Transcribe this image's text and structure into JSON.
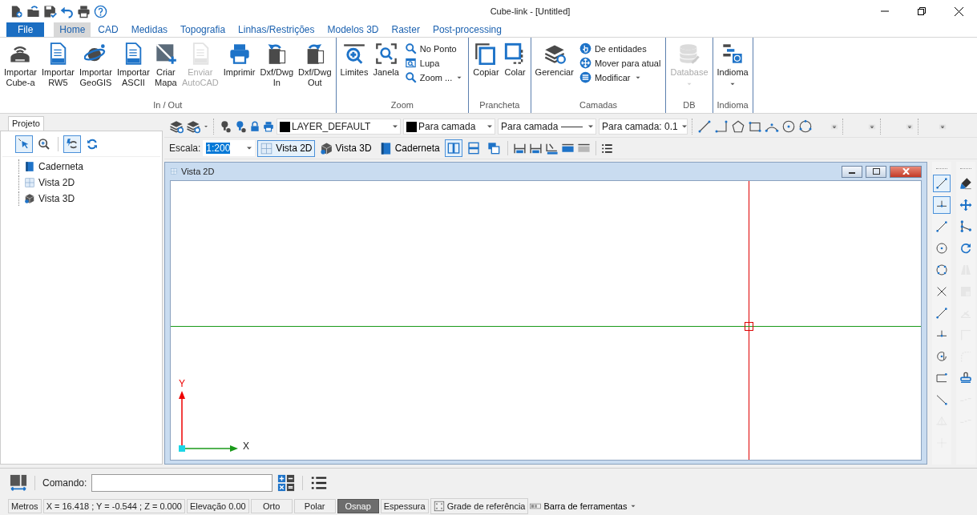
{
  "window": {
    "title": "Cube-link - [Untitled]"
  },
  "menu_tabs": [
    {
      "label": "File",
      "kind": "file",
      "selected": false
    },
    {
      "label": "Home",
      "kind": "tab",
      "selected": true
    },
    {
      "label": "CAD",
      "kind": "tab",
      "selected": false
    },
    {
      "label": "Medidas",
      "kind": "tab",
      "selected": false
    },
    {
      "label": "Topografia",
      "kind": "tab",
      "selected": false
    },
    {
      "label": "Linhas/Restrições",
      "kind": "tab",
      "selected": false
    },
    {
      "label": "Modelos 3D",
      "kind": "tab",
      "selected": false
    },
    {
      "label": "Raster",
      "kind": "tab",
      "selected": false
    },
    {
      "label": "Post-processing",
      "kind": "tab",
      "selected": false
    }
  ],
  "ribbon": {
    "groups": [
      {
        "label": "In / Out",
        "buttons": [
          {
            "label": "Importar\nCube-a",
            "kind": "large",
            "disabled": false,
            "dropdown": false
          },
          {
            "label": "Importar\nRW5",
            "kind": "large",
            "disabled": false,
            "dropdown": false
          },
          {
            "label": "Importar\nGeoGIS",
            "kind": "large",
            "disabled": false,
            "dropdown": false
          },
          {
            "label": "Importar\nASCII",
            "kind": "large",
            "disabled": false,
            "dropdown": false
          },
          {
            "label": "Criar\nMapa",
            "kind": "large",
            "disabled": false,
            "dropdown": false
          },
          {
            "label": "Enviar\nAutoCAD",
            "kind": "large",
            "disabled": true,
            "dropdown": false
          },
          {
            "label": "Imprimir",
            "kind": "large",
            "disabled": false,
            "dropdown": false
          },
          {
            "label": "Dxf/Dwg\nIn",
            "kind": "large",
            "disabled": false,
            "dropdown": false
          },
          {
            "label": "Dxf/Dwg\nOut",
            "kind": "large",
            "disabled": false,
            "dropdown": false
          }
        ]
      },
      {
        "label": "Zoom",
        "buttons": [
          {
            "label": "Limites",
            "kind": "large",
            "disabled": false,
            "dropdown": false
          },
          {
            "label": "Janela",
            "kind": "large",
            "disabled": false,
            "dropdown": false
          },
          {
            "label": "No Ponto",
            "kind": "small",
            "disabled": false,
            "dropdown": false
          },
          {
            "label": "Lupa",
            "kind": "small",
            "disabled": false,
            "dropdown": false
          },
          {
            "label": "Zoom ...",
            "kind": "small",
            "disabled": false,
            "dropdown": true
          }
        ]
      },
      {
        "label": "Prancheta",
        "buttons": [
          {
            "label": "Copiar",
            "kind": "large",
            "disabled": false,
            "dropdown": false
          },
          {
            "label": "Colar",
            "kind": "large",
            "disabled": false,
            "dropdown": false
          }
        ]
      },
      {
        "label": "Camadas",
        "buttons": [
          {
            "label": "Gerenciar",
            "kind": "large",
            "disabled": false,
            "dropdown": false
          },
          {
            "label": "De entidades",
            "kind": "small",
            "disabled": false,
            "dropdown": false
          },
          {
            "label": "Mover para atual",
            "kind": "small",
            "disabled": false,
            "dropdown": false
          },
          {
            "label": "Modificar",
            "kind": "small",
            "disabled": false,
            "dropdown": true
          }
        ]
      },
      {
        "label": "DB",
        "buttons": [
          {
            "label": "Database",
            "kind": "large",
            "disabled": true,
            "dropdown": true
          }
        ]
      },
      {
        "label": "Indioma",
        "buttons": [
          {
            "label": "Indioma",
            "kind": "large",
            "disabled": false,
            "dropdown": true
          }
        ]
      }
    ]
  },
  "layer_toolbar": {
    "layer": "LAYER_DEFAULT",
    "color_mode": "Para camada",
    "linetype": "Para camada",
    "lineweight": "Para camada: 0.1"
  },
  "view_toolbar": {
    "scale_label": "Escala:",
    "scale": "1:200",
    "scale_selected": true,
    "views": [
      {
        "label": "Vista 2D",
        "selected": true
      },
      {
        "label": "Vista 3D",
        "selected": false
      },
      {
        "label": "Caderneta",
        "selected": false
      }
    ],
    "layouts": [
      {
        "selected": true
      },
      {
        "selected": false
      },
      {
        "selected": false
      }
    ]
  },
  "project_panel": {
    "tab": "Projeto",
    "tools": [
      {
        "selected": true
      },
      {
        "selected": false
      },
      {
        "selected": true
      },
      {
        "selected": false
      }
    ],
    "tree": [
      {
        "label": "Caderneta"
      },
      {
        "label": "Vista 2D"
      },
      {
        "label": "Vista 3D"
      }
    ]
  },
  "document": {
    "title": "Vista 2D",
    "axis_y": "Y",
    "axis_x": "X"
  },
  "draw_toolbar": [
    {
      "selected": true,
      "disabled": false
    },
    {
      "selected": true,
      "disabled": false
    },
    {
      "selected": false,
      "disabled": false
    },
    {
      "selected": false,
      "disabled": false
    },
    {
      "selected": false,
      "disabled": false
    },
    {
      "selected": false,
      "disabled": false
    },
    {
      "selected": false,
      "disabled": false
    },
    {
      "selected": false,
      "disabled": false
    },
    {
      "selected": false,
      "disabled": false
    },
    {
      "selected": false,
      "disabled": false
    },
    {
      "selected": false,
      "disabled": false
    },
    {
      "selected": false,
      "disabled": true
    },
    {
      "selected": false,
      "disabled": true
    }
  ],
  "edit_toolbar": [
    {
      "selected": false,
      "disabled": false
    },
    {
      "selected": false,
      "disabled": false
    },
    {
      "selected": false,
      "disabled": false
    },
    {
      "selected": false,
      "disabled": false
    },
    {
      "selected": false,
      "disabled": true
    },
    {
      "selected": false,
      "disabled": true
    },
    {
      "selected": false,
      "disabled": true
    },
    {
      "selected": false,
      "disabled": true
    },
    {
      "selected": false,
      "disabled": true
    },
    {
      "selected": false,
      "disabled": false
    },
    {
      "selected": false,
      "disabled": true
    },
    {
      "selected": false,
      "disabled": true
    }
  ],
  "command": {
    "label": "Comando:"
  },
  "status_bar": [
    {
      "label": "Metros",
      "kind": "field"
    },
    {
      "label": "X = 16.418 ; Y = -0.544 ; Z = 0.000",
      "kind": "field"
    },
    {
      "label": "Elevação 0.00",
      "kind": "field"
    },
    {
      "label": "Orto",
      "kind": "toggle",
      "on": false
    },
    {
      "label": "Polar",
      "kind": "toggle",
      "on": false
    },
    {
      "label": "Osnap",
      "kind": "toggle",
      "on": true
    },
    {
      "label": "Espessura",
      "kind": "toggle",
      "on": false
    },
    {
      "label": "Grade de referência",
      "kind": "grid",
      "on": false
    },
    {
      "label": "Barra de ferramentas",
      "kind": "menu"
    }
  ]
}
